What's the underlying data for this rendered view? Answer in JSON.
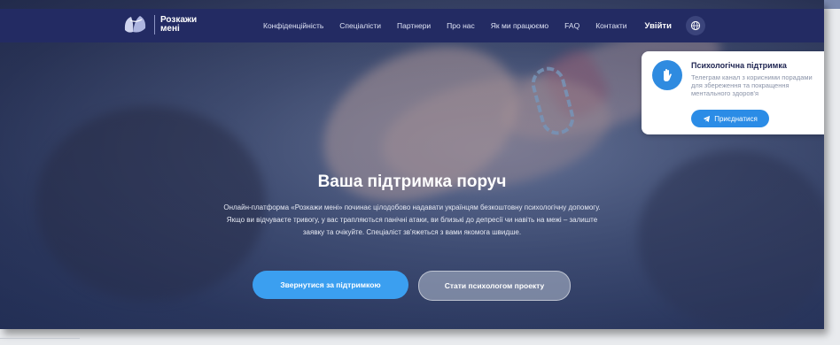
{
  "logo": {
    "line1": "Розкажи",
    "line2": "мені"
  },
  "nav": {
    "items": [
      "Конфіденційність",
      "Спеціалісти",
      "Партнери",
      "Про нас",
      "Як ми працюємо",
      "FAQ",
      "Контакти"
    ],
    "login": "Увійти",
    "language_icon": "globe-icon"
  },
  "support_card": {
    "title": "Психологічна підтримка",
    "desc_lines": [
      "Телеграм канал з корисними порадами",
      "для збереження та покращення",
      "ментального здоров'я"
    ],
    "button": "Приєднатися",
    "icon": "hand-wave-icon",
    "button_icon": "telegram-icon"
  },
  "hero": {
    "title": "Ваша підтримка поруч",
    "text": "Онлайн-платформа «Розкажи мені» починає цілодобово надавати українцям безкоштовну психологічну допомогу. Якщо ви відчуваєте тривогу, у вас трапляються панічні атаки, ви близькі до депресії чи навіть на межі – залиште заявку та очікуйте. Спеціаліст зв'яжеться з вами якомога швидше.",
    "primary_button": "Звернутися за підтримкою",
    "secondary_button": "Стати психологом проекту"
  },
  "colors": {
    "nav_bg": "#232b63",
    "accent_blue": "#3b9ff0",
    "card_button": "#2b8ce6"
  }
}
